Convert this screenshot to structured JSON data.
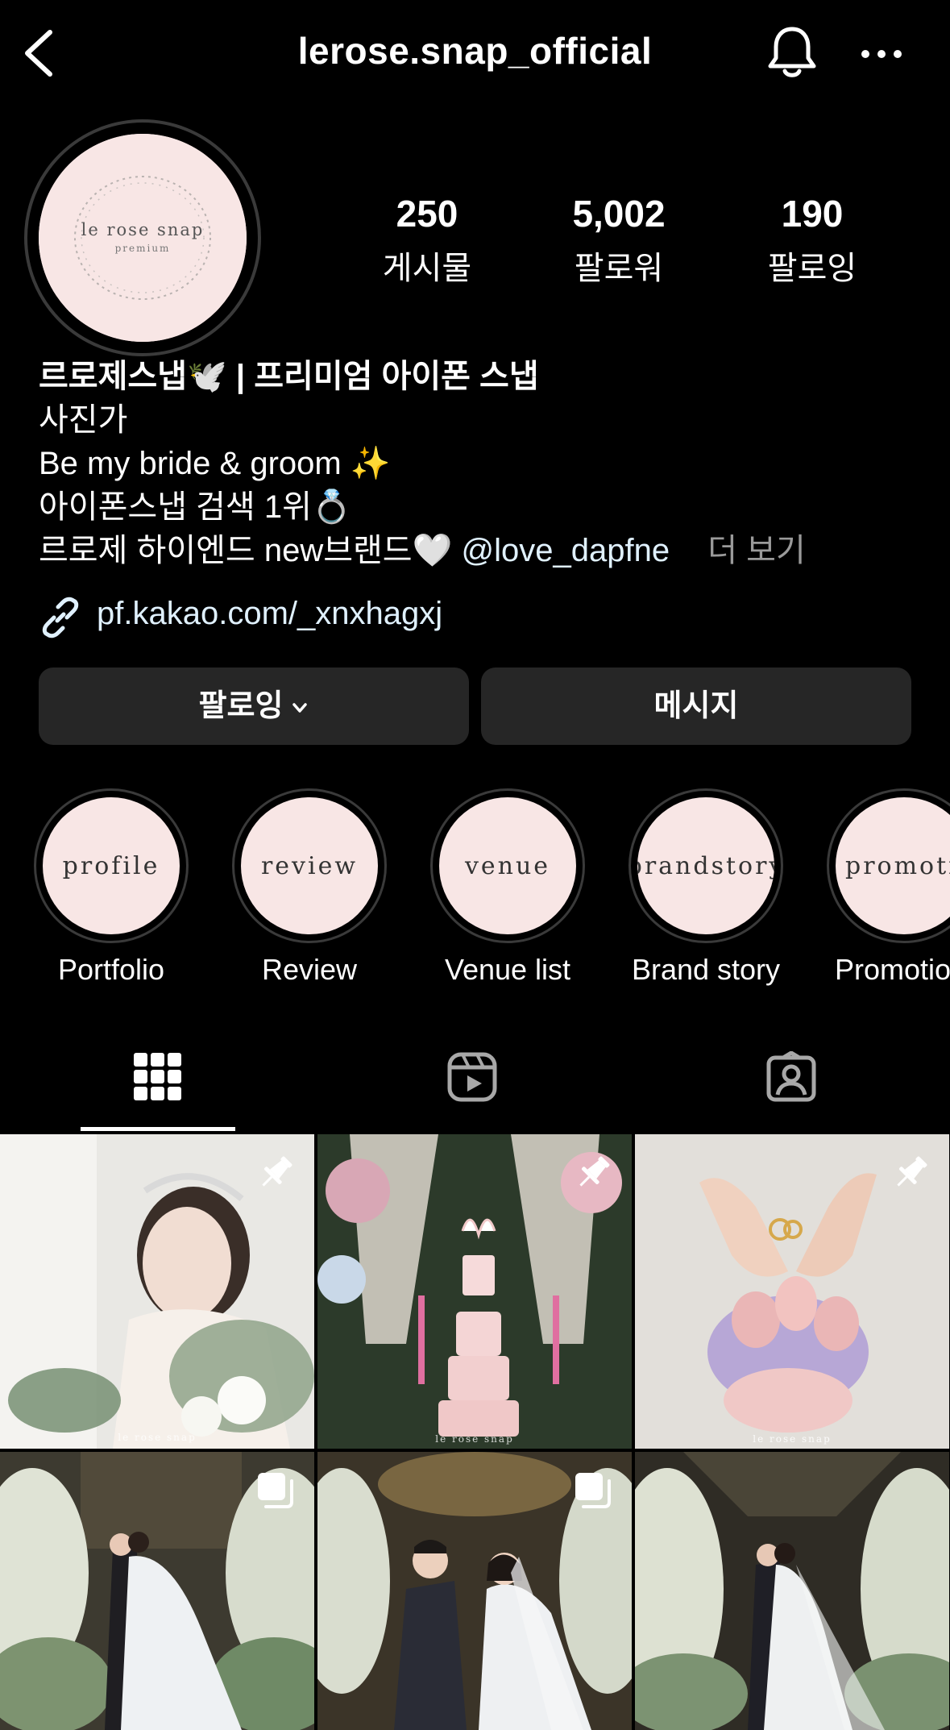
{
  "header": {
    "username": "lerose.snap_official"
  },
  "avatar": {
    "logo_text": "le rose snap",
    "logo_subtext": "premium"
  },
  "stats": [
    {
      "value": "250",
      "label": "게시물"
    },
    {
      "value": "5,002",
      "label": "팔로워"
    },
    {
      "value": "190",
      "label": "팔로잉"
    }
  ],
  "bio": {
    "name": "르로제스냅🕊️ | 프리미엄 아이폰 스냅",
    "category": "사진가",
    "lines": [
      "Be my bride & groom ✨",
      "아이폰스냅 검색 1위💍",
      "르로제 하이엔드 new브랜드🤍"
    ],
    "mention": "@love_dapfne",
    "more_label": "더 보기",
    "link": "pf.kakao.com/_xnxhagxj"
  },
  "buttons": {
    "follow_label": "팔로잉",
    "message_label": "메시지"
  },
  "highlights": [
    {
      "cover": "profile",
      "caption": "Portfolio"
    },
    {
      "cover": "review",
      "caption": "Review"
    },
    {
      "cover": "venue",
      "caption": "Venue list"
    },
    {
      "cover": "brandstory",
      "caption": "Brand story"
    },
    {
      "cover": "promotion",
      "caption": "Promotion"
    }
  ],
  "tabs": [
    {
      "name": "grid-icon",
      "active": true
    },
    {
      "name": "reels-icon",
      "active": false
    },
    {
      "name": "tagged-icon",
      "active": false
    }
  ],
  "posts": [
    {
      "badge": "pin-icon",
      "watermark": "le rose snap",
      "theme": "bride-portrait"
    },
    {
      "badge": "pin-icon",
      "watermark": "le rose snap",
      "theme": "wedding-cake"
    },
    {
      "badge": "pin-icon",
      "watermark": "le rose snap",
      "theme": "rings-bouquet"
    },
    {
      "badge": "carousel-icon",
      "watermark": "",
      "theme": "ceremony-kiss"
    },
    {
      "badge": "carousel-icon",
      "watermark": "",
      "theme": "couple-rings"
    },
    {
      "badge": "",
      "watermark": "",
      "theme": "aisle-kiss"
    }
  ],
  "colors": {
    "background": "#000000",
    "button_bg": "#262626",
    "highlight_bg": "#f8e6e5",
    "link": "#e0f1ff",
    "muted": "#9a9a9a"
  }
}
